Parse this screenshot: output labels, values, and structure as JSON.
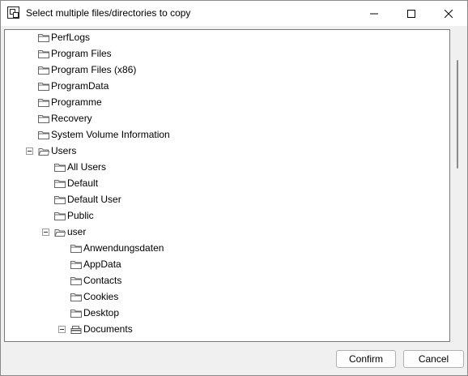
{
  "window": {
    "title": "Select multiple files/directories to copy",
    "app_icon": "copy-dialog-icon",
    "controls": [
      "minimize-icon",
      "maximize-icon",
      "close-icon"
    ]
  },
  "tree": {
    "nodes": [
      {
        "label": "PerfLogs",
        "level": 1,
        "expanded": false,
        "has_expander": false,
        "icon": "folder-closed-icon"
      },
      {
        "label": "Program Files",
        "level": 1,
        "expanded": false,
        "has_expander": false,
        "icon": "folder-closed-icon"
      },
      {
        "label": "Program Files (x86)",
        "level": 1,
        "expanded": false,
        "has_expander": false,
        "icon": "folder-closed-icon"
      },
      {
        "label": "ProgramData",
        "level": 1,
        "expanded": false,
        "has_expander": false,
        "icon": "folder-closed-icon"
      },
      {
        "label": "Programme",
        "level": 1,
        "expanded": false,
        "has_expander": false,
        "icon": "folder-closed-icon"
      },
      {
        "label": "Recovery",
        "level": 1,
        "expanded": false,
        "has_expander": false,
        "icon": "folder-closed-icon"
      },
      {
        "label": "System Volume Information",
        "level": 1,
        "expanded": false,
        "has_expander": false,
        "icon": "folder-closed-icon"
      },
      {
        "label": "Users",
        "level": 1,
        "expanded": true,
        "has_expander": true,
        "icon": "folder-open-icon"
      },
      {
        "label": "All Users",
        "level": 2,
        "expanded": false,
        "has_expander": false,
        "icon": "folder-closed-icon"
      },
      {
        "label": "Default",
        "level": 2,
        "expanded": false,
        "has_expander": false,
        "icon": "folder-closed-icon"
      },
      {
        "label": "Default User",
        "level": 2,
        "expanded": false,
        "has_expander": false,
        "icon": "folder-closed-icon"
      },
      {
        "label": "Public",
        "level": 2,
        "expanded": false,
        "has_expander": false,
        "icon": "folder-closed-icon"
      },
      {
        "label": "user",
        "level": 2,
        "expanded": true,
        "has_expander": true,
        "icon": "folder-open-icon"
      },
      {
        "label": "Anwendungsdaten",
        "level": 3,
        "expanded": false,
        "has_expander": false,
        "icon": "folder-closed-icon"
      },
      {
        "label": "AppData",
        "level": 3,
        "expanded": false,
        "has_expander": false,
        "icon": "folder-closed-icon"
      },
      {
        "label": "Contacts",
        "level": 3,
        "expanded": false,
        "has_expander": false,
        "icon": "folder-closed-icon"
      },
      {
        "label": "Cookies",
        "level": 3,
        "expanded": false,
        "has_expander": false,
        "icon": "folder-closed-icon"
      },
      {
        "label": "Desktop",
        "level": 3,
        "expanded": false,
        "has_expander": false,
        "icon": "folder-closed-icon"
      },
      {
        "label": "Documents",
        "level": 3,
        "expanded": true,
        "has_expander": true,
        "icon": "documents-folder-icon"
      }
    ]
  },
  "buttons": {
    "confirm": "Confirm",
    "cancel": "Cancel"
  }
}
